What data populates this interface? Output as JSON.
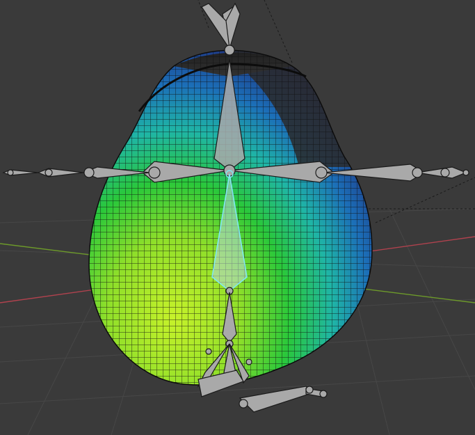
{
  "viewport": {
    "kind": "3d-weight-paint-view",
    "colors": {
      "background": "#3a3a3a",
      "grid": "#474747",
      "axis_x": "#b0424e",
      "axis_y": "#6d9a2a",
      "wire": "#101010",
      "bone_fill": "#a9a9a9",
      "bone_stroke": "#1a1a1a",
      "bone_selected": "#7fe7f0",
      "weight_low": "#1e2d7a",
      "weight_mid": "#1fb5a6",
      "weight_high": "#c7f22a"
    },
    "objects": [
      {
        "name": "mesh",
        "shape": "pear-body",
        "display": "weight-paint"
      },
      {
        "name": "armature",
        "display": "octahedral-bones",
        "selected_bone": "spine-lower"
      }
    ]
  }
}
